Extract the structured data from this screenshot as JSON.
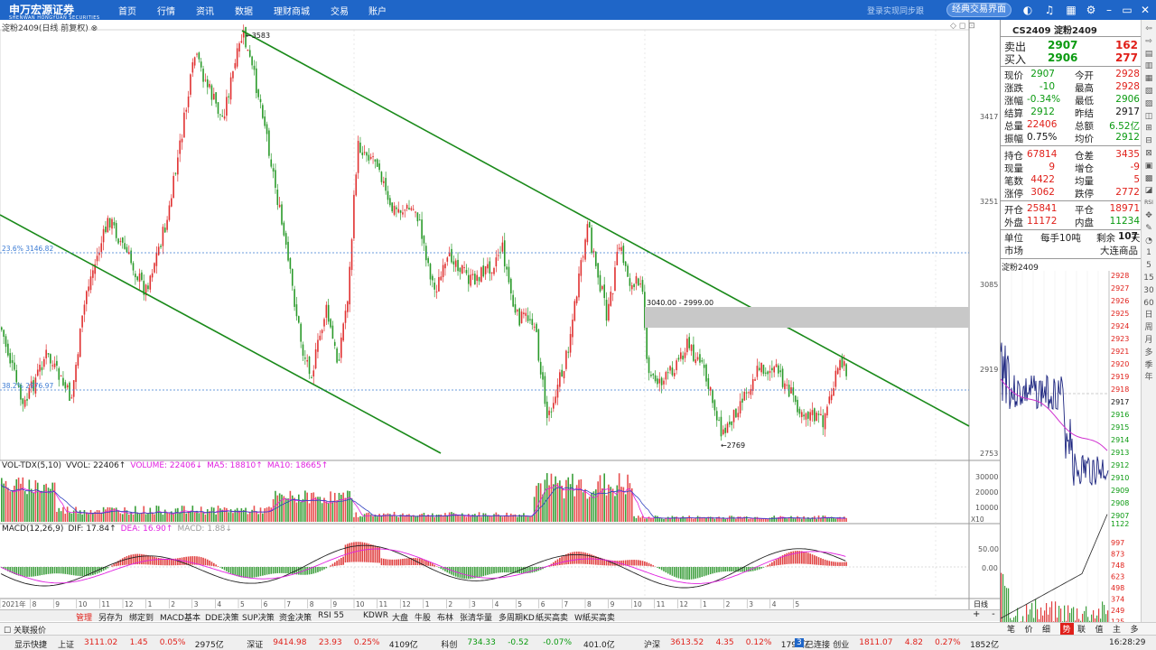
{
  "topbar": {
    "logo": "申万宏源证券",
    "logo_sub": "SHENWAN HONGYUAN SECURITIES",
    "nav": [
      "首页",
      "行情",
      "资讯",
      "数据",
      "理财商城",
      "交易",
      "账户"
    ],
    "login_hint": "登录实现同步跟",
    "classic_btn": "经典交易界面"
  },
  "chart": {
    "title": "淀粉2409(日线 前复权)",
    "price_labels": [
      "3417",
      "3251",
      "3085",
      "2919",
      "2753"
    ],
    "fib1": "23.6% 3146.82",
    "fib2": "38.2% 2976.97",
    "high_label": "3583",
    "low_label": "2769",
    "gap_label": "3040.00 - 2999.00",
    "x_labels": [
      "2021年",
      "8",
      "9",
      "10",
      "11",
      "12",
      "1",
      "2",
      "3",
      "4",
      "5",
      "6",
      "7",
      "8",
      "9",
      "10",
      "11",
      "12",
      "1",
      "2",
      "3",
      "4",
      "5",
      "6",
      "7",
      "8",
      "9",
      "10",
      "11",
      "12",
      "1",
      "2",
      "3",
      "4",
      "5"
    ],
    "x_right_label": "日线"
  },
  "vol": {
    "items": [
      "VOL-TDX(5,10)",
      "VVOL: 22406↑",
      "VOLUME: 22406↓",
      "MA5: 18810↑",
      "MA10: 18665↑"
    ],
    "colors": [
      "#222",
      "#222",
      "#e020e0",
      "#e020e0",
      "#e020e0"
    ],
    "scale": [
      "30000",
      "20000",
      "10000"
    ],
    "unit": "X10"
  },
  "macd": {
    "items": [
      "MACD(12,26,9)",
      "DIF: 17.84↑",
      "DEA: 16.90↑",
      "MACD: 1.88↓"
    ],
    "colors": [
      "#222",
      "#222",
      "#e020e0",
      "#999"
    ],
    "scale": [
      "50.00",
      "0.00"
    ]
  },
  "quote": {
    "code": "CS2409 淀粉2409",
    "sell": {
      "label": "卖出",
      "price": "2907",
      "qty": "162"
    },
    "buy": {
      "label": "买入",
      "price": "2906",
      "qty": "277"
    },
    "rows1": [
      {
        "l1": "现价",
        "v1": "2907",
        "c1": "grn",
        "l2": "今开",
        "v2": "2928",
        "c2": "red"
      },
      {
        "l1": "涨跌",
        "v1": "-10",
        "c1": "grn",
        "l2": "最高",
        "v2": "2928",
        "c2": "red"
      },
      {
        "l1": "涨幅",
        "v1": "-0.34%",
        "c1": "grn",
        "l2": "最低",
        "v2": "2906",
        "c2": "grn"
      },
      {
        "l1": "结算",
        "v1": "2912",
        "c1": "grn",
        "l2": "昨结",
        "v2": "2917",
        "c2": "blk"
      },
      {
        "l1": "总量",
        "v1": "22406",
        "c1": "red",
        "l2": "总额",
        "v2": "6.52亿",
        "c2": "grn"
      },
      {
        "l1": "振幅",
        "v1": "0.75%",
        "c1": "blk",
        "l2": "均价",
        "v2": "2912",
        "c2": "grn"
      }
    ],
    "rows2": [
      {
        "l1": "持仓",
        "v1": "67814",
        "c1": "red",
        "l2": "仓差",
        "v2": "3435",
        "c2": "red"
      },
      {
        "l1": "现量",
        "v1": "9",
        "c1": "red",
        "l2": "增仓",
        "v2": "-9",
        "c2": "red"
      },
      {
        "l1": "笔数",
        "v1": "4422",
        "c1": "red",
        "l2": "均量",
        "v2": "5",
        "c2": "red"
      },
      {
        "l1": "涨停",
        "v1": "3062",
        "c1": "red",
        "l2": "跌停",
        "v2": "2772",
        "c2": "red"
      }
    ],
    "rows3": [
      {
        "l1": "开仓",
        "v1": "25841",
        "c1": "red",
        "l2": "平仓",
        "v2": "18971",
        "c2": "red"
      },
      {
        "l1": "外盘",
        "v1": "11172",
        "c1": "red",
        "l2": "内盘",
        "v2": "11234",
        "c2": "grn"
      }
    ],
    "unit_label": "单位",
    "unit_val": "每手10吨",
    "remain_label": "剩余",
    "remain_val": "107",
    "remain_unit": "天",
    "market_label": "市场",
    "market_val": "大连商品",
    "mini_title": "淀粉2409",
    "mini_prices": [
      "2928",
      "2927",
      "2926",
      "2925",
      "2924",
      "2923",
      "2921",
      "2920",
      "2919",
      "2918",
      "2917",
      "2916",
      "2915",
      "2914",
      "2913",
      "2912",
      "2910",
      "2909",
      "2908",
      "2907",
      "1122"
    ],
    "mini_vol": [
      "997",
      "873",
      "748",
      "623",
      "498",
      "374",
      "249",
      "125"
    ],
    "right_tabs": [
      "笔",
      "价",
      "细",
      "势",
      "联",
      "值",
      "主",
      "多"
    ]
  },
  "bottom_tabs": [
    "管理",
    "另存为",
    "绑定到",
    "MACD基本",
    "DDE决策",
    "SUP决策",
    "资金决策",
    "RSI 55",
    "KDWR",
    "大盘",
    "牛股",
    "布林",
    "张清华量",
    "多周期KD",
    "紙买高卖",
    "W紙买高卖"
  ],
  "status": {
    "quote_label": "关联报价"
  },
  "ticker": [
    {
      "t": "显示快捷",
      "c": "#222"
    },
    {
      "t": "上证",
      "c": "#222"
    },
    {
      "t": "3111.02",
      "c": "#e0201a"
    },
    {
      "t": "1.45",
      "c": "#e0201a"
    },
    {
      "t": "0.05%",
      "c": "#e0201a"
    },
    {
      "t": "2975亿",
      "c": "#222"
    },
    {
      "t": "深证",
      "c": "#222"
    },
    {
      "t": "9414.98",
      "c": "#e0201a"
    },
    {
      "t": "23.93",
      "c": "#e0201a"
    },
    {
      "t": "0.25%",
      "c": "#e0201a"
    },
    {
      "t": "4109亿",
      "c": "#222"
    },
    {
      "t": "科创",
      "c": "#222"
    },
    {
      "t": "734.33",
      "c": "#0a9a10"
    },
    {
      "t": "-0.52",
      "c": "#0a9a10"
    },
    {
      "t": "-0.07%",
      "c": "#0a9a10"
    },
    {
      "t": "401.0亿",
      "c": "#222"
    },
    {
      "t": "沪深",
      "c": "#222"
    },
    {
      "t": "3613.52",
      "c": "#e0201a"
    },
    {
      "t": "4.35",
      "c": "#e0201a"
    },
    {
      "t": "0.12%",
      "c": "#e0201a"
    },
    {
      "t": "1791亿",
      "c": "#222"
    },
    {
      "t": "创业",
      "c": "#222"
    },
    {
      "t": "1811.07",
      "c": "#e0201a"
    },
    {
      "t": "4.82",
      "c": "#e0201a"
    },
    {
      "t": "0.27%",
      "c": "#e0201a"
    },
    {
      "t": "1852亿",
      "c": "#222"
    }
  ],
  "conn": {
    "num": "3",
    "label": "已连接",
    "time": "16:28:29"
  }
}
